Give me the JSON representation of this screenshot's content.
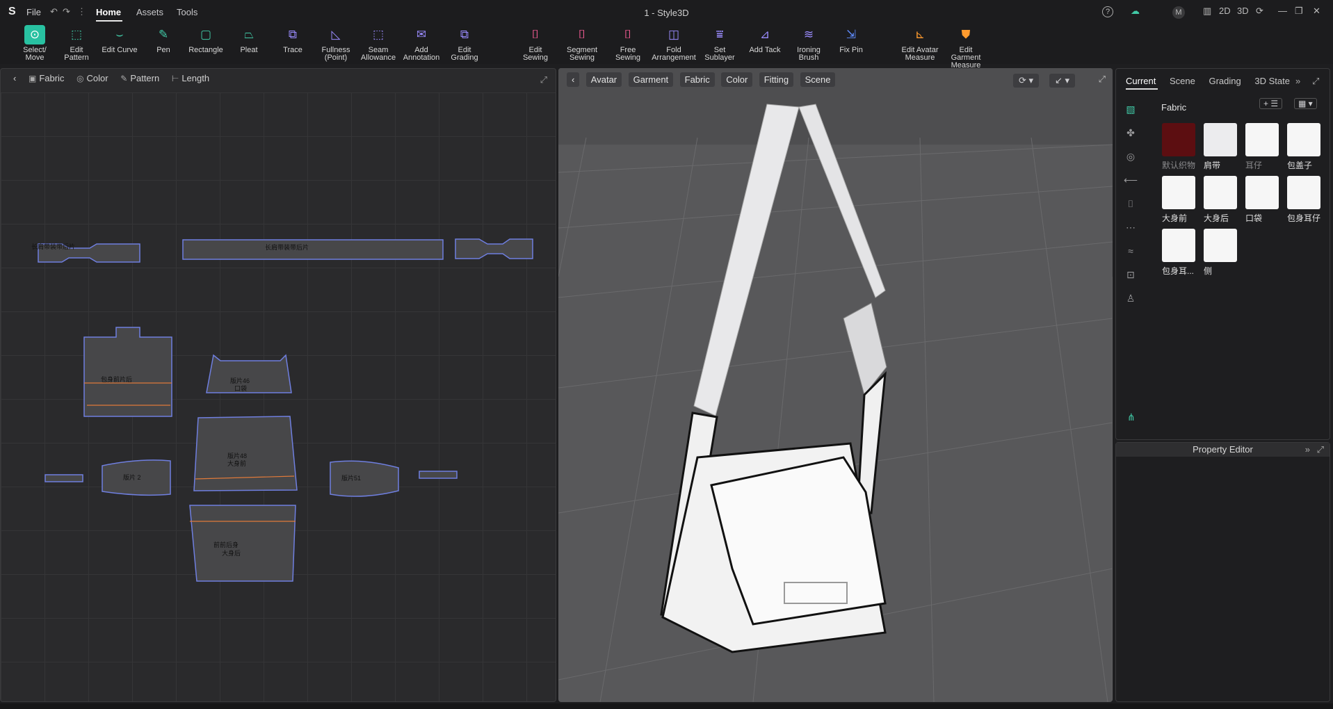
{
  "app": {
    "title": "1 - Style3D",
    "logo": "S"
  },
  "menu": {
    "file": "File",
    "undo": "↶",
    "redo": "↷",
    "more": "⋮",
    "home": "Home",
    "assets": "Assets",
    "tools": "Tools"
  },
  "window": {
    "help": "?",
    "cloud": "☁",
    "user": "M",
    "layout_icon": "▥",
    "mode_2d": "2D",
    "mode_3d": "3D",
    "refresh": "⟳",
    "minimize": "—",
    "restore": "❐",
    "close": "✕"
  },
  "toolbar": [
    {
      "label1": "Select/",
      "label2": "Move",
      "icon": "select-icon",
      "glyph": "⊙",
      "color": "sel"
    },
    {
      "label1": "Edit",
      "label2": "Pattern",
      "icon": "edit-pattern-icon",
      "glyph": "⬚",
      "color": "green"
    },
    {
      "label1": "Edit Curve",
      "label2": "",
      "icon": "edit-curve-icon",
      "glyph": "⌣",
      "color": "green"
    },
    {
      "label1": "Pen",
      "label2": "",
      "icon": "pen-icon",
      "glyph": "✎",
      "color": "green"
    },
    {
      "label1": "Rectangle",
      "label2": "",
      "icon": "rectangle-icon",
      "glyph": "▢",
      "color": "green"
    },
    {
      "label1": "Pleat",
      "label2": "",
      "icon": "pleat-icon",
      "glyph": "⏢",
      "color": "green"
    },
    {
      "label1": "Trace",
      "label2": "",
      "icon": "trace-icon",
      "glyph": "⧉",
      "color": "purple"
    },
    {
      "label1": "Fullness",
      "label2": "(Point)",
      "icon": "fullness-icon",
      "glyph": "◺",
      "color": "purple"
    },
    {
      "label1": "Seam",
      "label2": "Allowance",
      "icon": "seam-allowance-icon",
      "glyph": "⬚",
      "color": "purple"
    },
    {
      "label1": "Add",
      "label2": "Annotation",
      "icon": "annotation-icon",
      "glyph": "✉",
      "color": "purple"
    },
    {
      "label1": "Edit",
      "label2": "Grading",
      "icon": "grading-icon",
      "glyph": "⧉",
      "color": "purple"
    },
    {
      "label1": "Edit",
      "label2": "Sewing",
      "icon": "edit-sewing-icon",
      "glyph": "⌷",
      "color": "pink"
    },
    {
      "label1": "Segment",
      "label2": "Sewing",
      "icon": "segment-sewing-icon",
      "glyph": "⌷",
      "color": "pink"
    },
    {
      "label1": "Free",
      "label2": "Sewing",
      "icon": "free-sewing-icon",
      "glyph": "⌷",
      "color": "pink"
    },
    {
      "label1": "Fold",
      "label2": "Arrangement",
      "icon": "fold-icon",
      "glyph": "◫",
      "color": "purple"
    },
    {
      "label1": "Set",
      "label2": "Sublayer",
      "icon": "sublayer-icon",
      "glyph": "⩸",
      "color": "purple"
    },
    {
      "label1": "Add Tack",
      "label2": "",
      "icon": "tack-icon",
      "glyph": "⊿",
      "color": "purple"
    },
    {
      "label1": "Ironing",
      "label2": "Brush",
      "icon": "ironing-icon",
      "glyph": "≋",
      "color": "purple"
    },
    {
      "label1": "Fix Pin",
      "label2": "",
      "icon": "pin-icon",
      "glyph": "⇲",
      "color": "blue"
    },
    {
      "label1": "Edit Avatar",
      "label2": "Measure",
      "icon": "avatar-measure-icon",
      "glyph": "⊾",
      "color": "orange"
    },
    {
      "label1": "Edit Garment",
      "label2": "Measure",
      "icon": "garment-measure-icon",
      "glyph": "⛊",
      "color": "orange"
    }
  ],
  "pattern_panel": {
    "back": "‹",
    "tabs": [
      "Fabric",
      "Color",
      "Pattern",
      "Length"
    ],
    "expand": "⤢"
  },
  "pattern_labels": [
    "长肩带装带后片",
    "长肩带装带后片",
    "包身前片后",
    "版片46",
    "口袋",
    "版片48",
    "大身前",
    "版片 2",
    "版片51",
    "前前后身",
    "大身后"
  ],
  "view_panel": {
    "back": "‹",
    "tabs": [
      "Avatar",
      "Garment",
      "Fabric",
      "Color",
      "Fitting",
      "Scene"
    ],
    "expand": "⤢"
  },
  "right_panel": {
    "tabs": [
      "Current",
      "Scene",
      "Grading",
      "3D State"
    ],
    "more": "»",
    "expand": "⤢",
    "fabric_title": "Fabric",
    "add": "+",
    "list": "☰",
    "grid": "▦",
    "fabrics": [
      {
        "name": "默认织物",
        "color": "#5c0e11"
      },
      {
        "name": "肩带",
        "color": "#ececee"
      },
      {
        "name": "耳仔",
        "color": "#f6f6f6"
      },
      {
        "name": "包盖子",
        "color": "#f6f6f6"
      },
      {
        "name": "大身前",
        "color": "#f6f6f6"
      },
      {
        "name": "大身后",
        "color": "#f6f6f6"
      },
      {
        "name": "口袋",
        "color": "#f6f6f6"
      },
      {
        "name": "包身耳仔",
        "color": "#f6f6f6"
      },
      {
        "name": "包身耳...",
        "color": "#f6f6f6"
      },
      {
        "name": "侧",
        "color": "#f6f6f6"
      }
    ]
  },
  "property_editor": {
    "title": "Property Editor",
    "more": "»",
    "expand": "⤢"
  }
}
